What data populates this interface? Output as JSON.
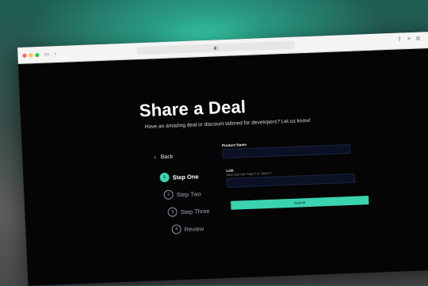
{
  "window": {
    "controls": [
      "close",
      "minimize",
      "maximize"
    ]
  },
  "page": {
    "title": "Share a Deal",
    "subtitle": "Have an amazing deal or discount tailored for developers? Let us know!",
    "back_label": "Back"
  },
  "steps": [
    {
      "number": "1",
      "label": "Step One",
      "active": true
    },
    {
      "number": "2",
      "label": "Step Two",
      "active": false
    },
    {
      "number": "3",
      "label": "Step Three",
      "active": false
    },
    {
      "number": "4",
      "label": "Review",
      "active": false
    }
  ],
  "form": {
    "product_name_label": "Product Name",
    "product_name_value": "",
    "link_label": "Link",
    "link_hint": "Must start with \"http://\" or \"https://\"",
    "link_value": "",
    "submit_label": "Submit"
  },
  "colors": {
    "accent": "#3ad3b0",
    "background": "#050505",
    "field_bg": "#0c1024"
  },
  "icons": [
    "sidebar-toggle-icon",
    "back-chevron-icon",
    "shield-icon",
    "share-icon",
    "new-tab-icon",
    "tabs-icon"
  ]
}
